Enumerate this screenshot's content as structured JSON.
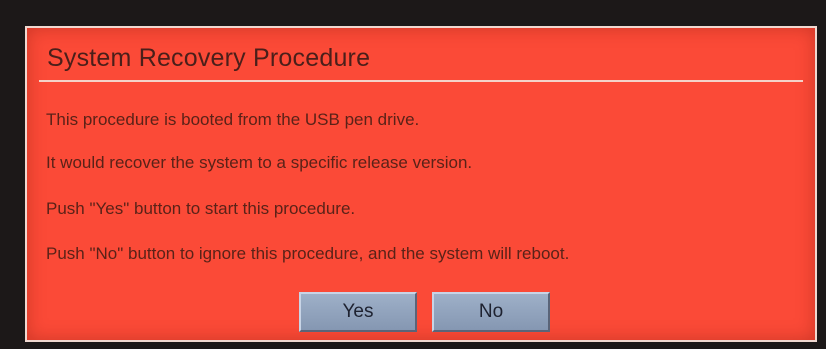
{
  "dialog": {
    "title": "System Recovery Procedure",
    "lines": [
      "This procedure is booted from the USB pen drive.",
      "It would recover the system to a specific release version.",
      "Push \"Yes\" button to start this procedure.",
      "Push \"No\" button to ignore this procedure, and the system will reboot."
    ],
    "buttons": {
      "yes_label": "Yes",
      "no_label": "No"
    }
  },
  "colors": {
    "dialog_background": "#fb4a37",
    "text": "#5a2218",
    "button": "#9eb0c8"
  }
}
